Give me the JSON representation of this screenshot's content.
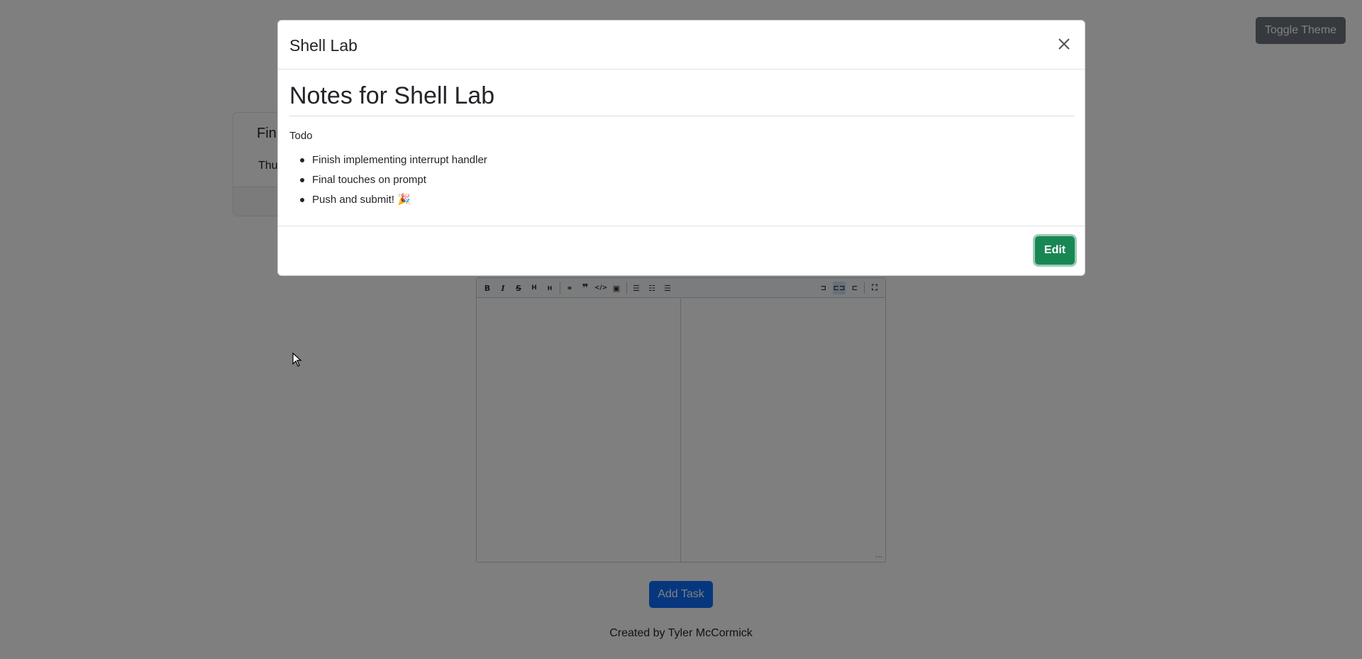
{
  "header": {
    "toggle_theme_label": "Toggle Theme"
  },
  "task_card": {
    "title": "Fin",
    "date": "Thu"
  },
  "editor": {
    "toolbar_icons": [
      "bold-icon",
      "italic-icon",
      "strikethrough-icon",
      "heading-icon",
      "heading-smaller-icon",
      "link-icon",
      "quote-icon",
      "code-icon",
      "image-icon",
      "unordered-list-icon",
      "ordered-list-icon",
      "checklist-icon",
      "toggle-preview-icon",
      "side-by-side-icon",
      "split-left-icon",
      "fullscreen-icon"
    ]
  },
  "add_task_label": "Add Task",
  "footer": {
    "credit": "Created by Tyler McCormick"
  },
  "modal": {
    "title": "Shell Lab",
    "notes_heading": "Notes for Shell Lab",
    "subheading": "Todo",
    "items": [
      "Finish implementing interrupt handler",
      "Final touches on prompt",
      "Push and submit! 🎉"
    ],
    "edit_label": "Edit"
  }
}
